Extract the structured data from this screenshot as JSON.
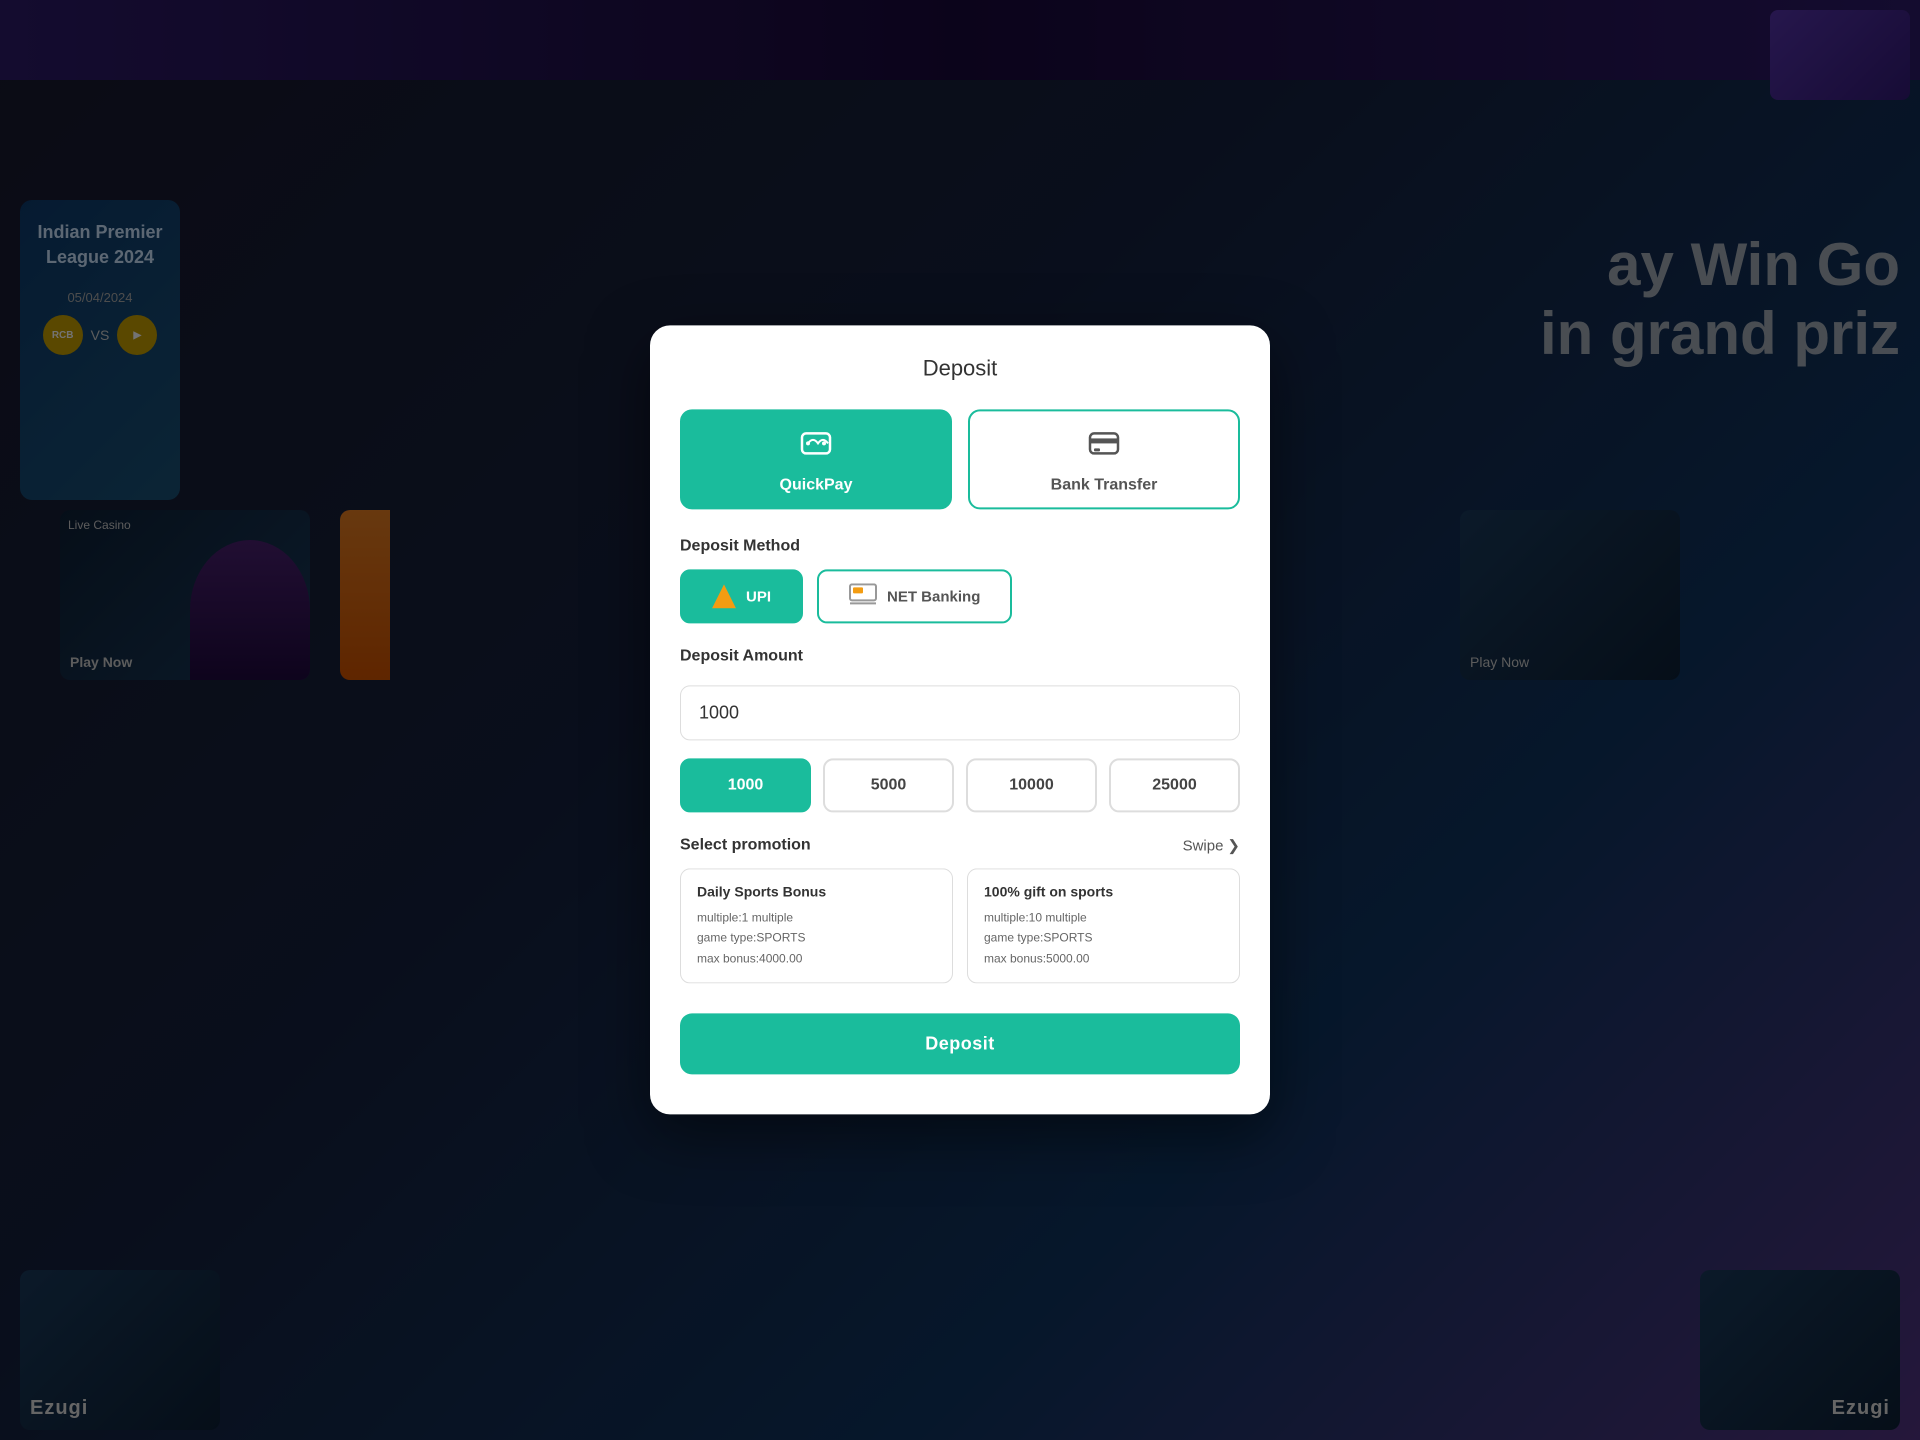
{
  "modal": {
    "title": "Deposit",
    "payment_methods": [
      {
        "id": "quickpay",
        "label": "QuickPay",
        "active": true
      },
      {
        "id": "bank",
        "label": "Bank Transfer",
        "active": false
      }
    ],
    "deposit_method_label": "Deposit Method",
    "deposit_methods": [
      {
        "id": "upi",
        "label": "UPI",
        "active": true
      },
      {
        "id": "net",
        "label": "NET Banking",
        "active": false
      }
    ],
    "deposit_amount_label": "Deposit Amount",
    "amount_value": "1000",
    "quick_amounts": [
      {
        "value": "1000",
        "active": true
      },
      {
        "value": "5000",
        "active": false
      },
      {
        "value": "10000",
        "active": false
      },
      {
        "value": "25000",
        "active": false
      }
    ],
    "select_promotion_label": "Select promotion",
    "swipe_label": "Swipe",
    "promotions": [
      {
        "title": "Daily Sports Bonus",
        "multiple": "multiple:1 multiple",
        "game_type": "game type:SPORTS",
        "max_bonus": "max bonus:4000.00"
      },
      {
        "title": "100% gift on sports",
        "multiple": "multiple:10 multiple",
        "game_type": "game type:SPORTS",
        "max_bonus": "max bonus:5000.00"
      }
    ],
    "deposit_button_label": "Deposit"
  },
  "background": {
    "promo_line1": "ay Win Go",
    "promo_line2": "in grand priz",
    "cricket_match": {
      "league": "Indian Premier League 2024",
      "date": "05/04/2024",
      "vs": "VS"
    },
    "live_casino_label": "Live Casino",
    "play_now_label": "Play Now",
    "ezugi_label": "Ezugi"
  }
}
